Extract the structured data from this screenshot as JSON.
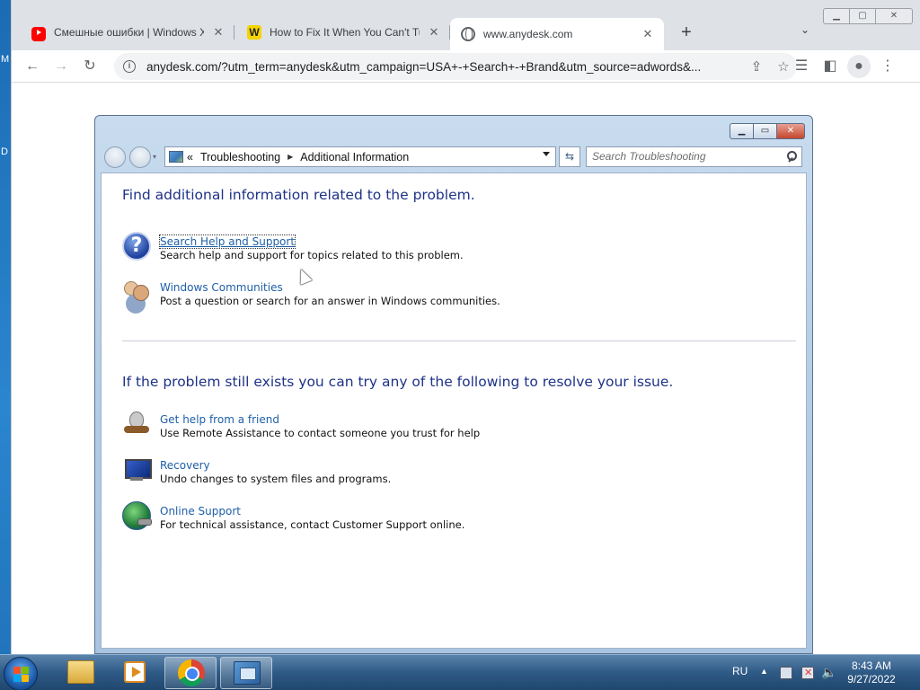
{
  "browser": {
    "tabs": [
      {
        "title": "Смешные ошибки | Windows XP",
        "favicon": "youtube-icon"
      },
      {
        "title": "How to Fix It When You Can't Turn",
        "favicon": "w-icon"
      },
      {
        "title": "www.anydesk.com",
        "favicon": "globe-icon"
      }
    ],
    "new_tab": "+",
    "address": "anydesk.com/?utm_term=anydesk&utm_campaign=USA+-+Search+-+Brand&utm_source=adwords&..."
  },
  "window": {
    "breadcrumb": [
      "Troubleshooting",
      "Additional Information"
    ],
    "breadcrumb_prefix": "«",
    "search_placeholder": "Search Troubleshooting"
  },
  "content": {
    "heading1": "Find additional information related to the problem.",
    "items1": [
      {
        "link": "Search Help and Support",
        "desc": "Search help and support for topics related to this problem."
      },
      {
        "link": "Windows Communities",
        "desc": "Post a question or search for an answer in Windows communities."
      }
    ],
    "heading2": "If the problem still exists you can try any of the following to resolve your issue.",
    "items2": [
      {
        "link": "Get help from a friend",
        "desc": "Use Remote Assistance to contact someone you trust for help"
      },
      {
        "link": "Recovery",
        "desc": "Undo changes to system files and programs."
      },
      {
        "link": "Online Support",
        "desc": "For technical assistance, contact Customer Support online."
      }
    ]
  },
  "taskbar": {
    "language": "RU",
    "time": "8:43 AM",
    "date": "9/27/2022"
  },
  "colors": {
    "link": "#1e5fa8",
    "heading": "#1e3287",
    "taskbar": "#2e5a86"
  }
}
